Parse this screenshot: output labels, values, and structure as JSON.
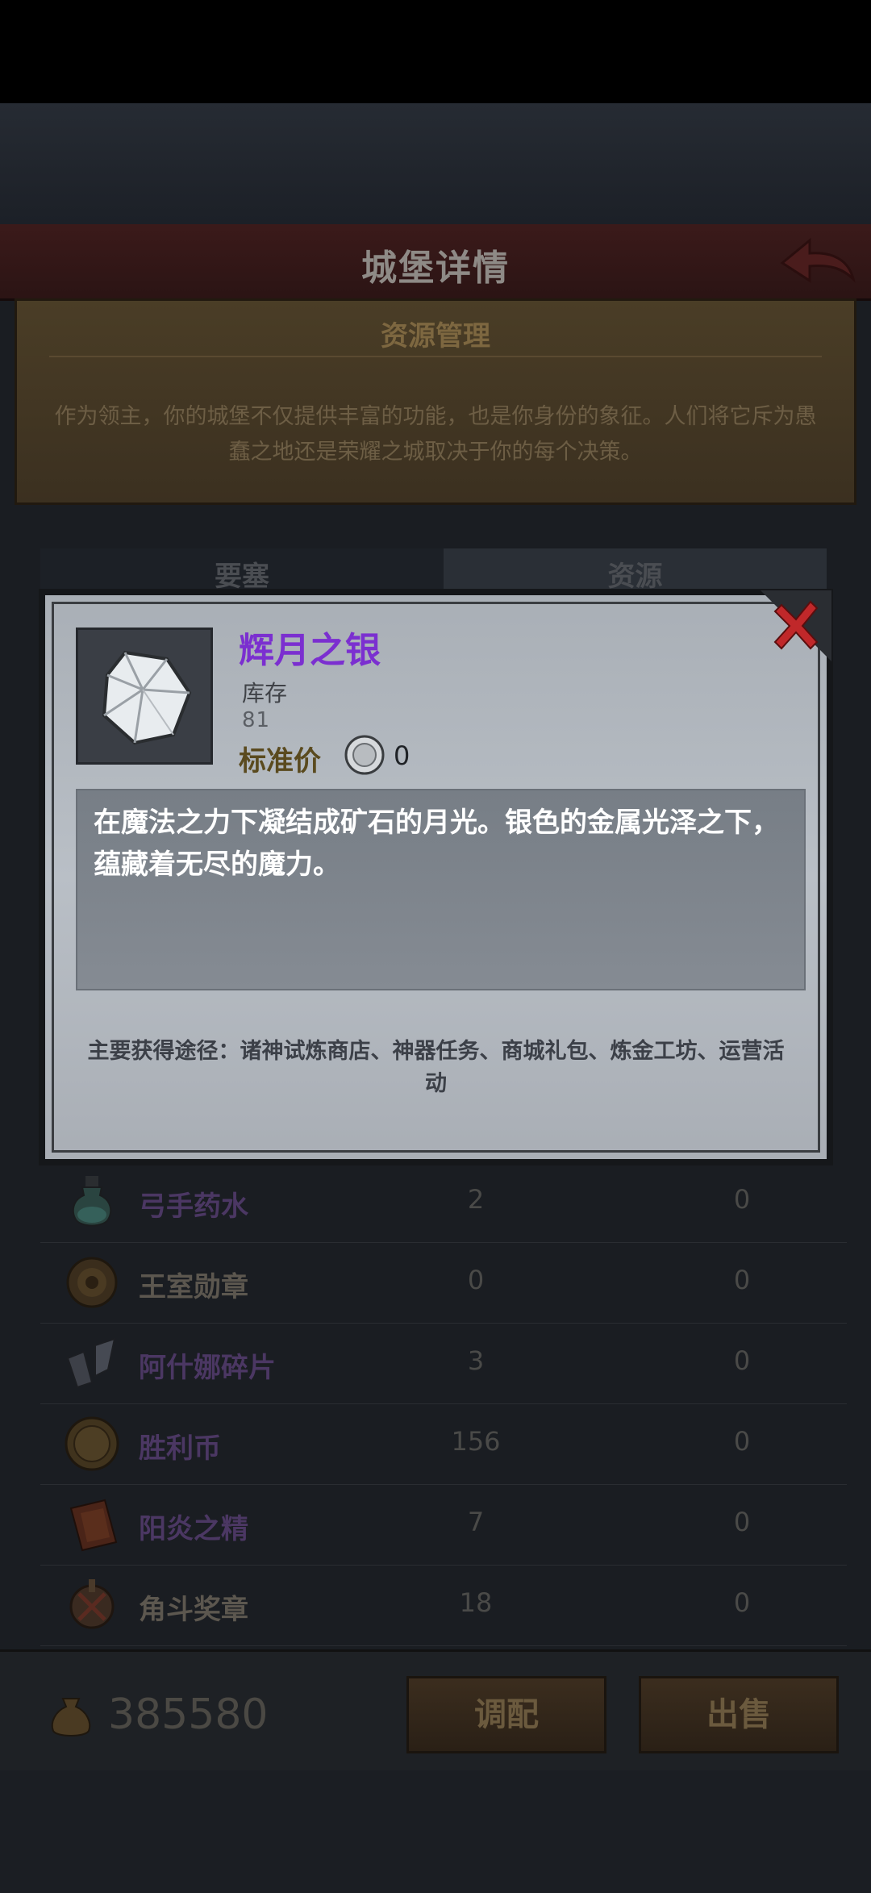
{
  "header": {
    "title": "城堡详情"
  },
  "info": {
    "title": "资源管理",
    "description": "作为领主，你的城堡不仅提供丰富的功能，也是你身份的象征。人们将它斥为愚蠢之地还是荣耀之城取决于你的每个决策。"
  },
  "tabs": [
    {
      "label": "要塞"
    },
    {
      "label": "资源"
    }
  ],
  "modal": {
    "item_name": "辉月之银",
    "stock_label": "库存",
    "stock_value": "81",
    "price_label": "标准价",
    "price_value": "0",
    "description": "在魔法之力下凝结成矿石的月光。银色的金属光泽之下，蕴藏着无尽的魔力。",
    "source": "主要获得途径：诸神试炼商店、神器任务、商城礼包、炼金工坊、运营活动"
  },
  "items": [
    {
      "name": "弓手药水",
      "qty": "2",
      "value": "0",
      "color": "purple",
      "icon": "potion-icon"
    },
    {
      "name": "王室勋章",
      "qty": "0",
      "value": "0",
      "color": "beige",
      "icon": "medal-icon"
    },
    {
      "name": "阿什娜碎片",
      "qty": "3",
      "value": "0",
      "color": "purple",
      "icon": "shard-icon"
    },
    {
      "name": "胜利币",
      "qty": "156",
      "value": "0",
      "color": "purple",
      "icon": "coin-icon"
    },
    {
      "name": "阳炎之精",
      "qty": "7",
      "value": "0",
      "color": "purple",
      "icon": "essence-icon"
    },
    {
      "name": "角斗奖章",
      "qty": "18",
      "value": "0",
      "color": "beige",
      "icon": "gladiator-badge-icon"
    }
  ],
  "footer": {
    "gold": "385580",
    "mix_label": "调配",
    "sell_label": "出售"
  }
}
